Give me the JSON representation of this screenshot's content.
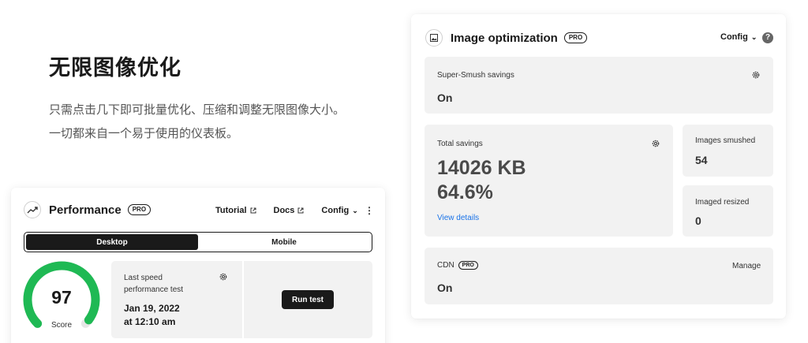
{
  "hero": {
    "title": "无限图像优化",
    "line1": "只需点击几下即可批量优化、压缩和调整无限图像大小。",
    "line2": "一切都来自一个易于使用的仪表板。"
  },
  "image_optimization": {
    "title": "Image optimization",
    "pro_badge": "PRO",
    "config_label": "Config",
    "help": "?",
    "super_smush": {
      "label": "Super-Smush savings",
      "value": "On"
    },
    "total_savings": {
      "label": "Total savings",
      "size": "14026 KB",
      "percent": "64.6%",
      "link": "View details"
    },
    "images_smushed": {
      "label": "Images smushed",
      "value": "54"
    },
    "images_resized": {
      "label": "Imaged resized",
      "value": "0"
    },
    "cdn": {
      "label": "CDN",
      "pro_badge": "PRO",
      "manage": "Manage",
      "value": "On"
    }
  },
  "performance": {
    "title": "Performance",
    "pro_badge": "PRO",
    "nav": {
      "tutorial": "Tutorial",
      "docs": "Docs",
      "config": "Config"
    },
    "tabs": {
      "desktop": "Desktop",
      "mobile": "Mobile"
    },
    "score": "97",
    "score_label": "Score",
    "score_fraction": 0.97,
    "last_test_label": "Last speed performance test",
    "date": "Jan 19, 2022",
    "time": "at 12:10 am",
    "run_button": "Run test"
  },
  "colors": {
    "score_green": "#1fb954",
    "gauge_track": "#e6e6e6",
    "link_blue": "#1a73e8",
    "dark": "#1a1a1a",
    "panel_bg": "#f2f2f2"
  },
  "icons": {
    "image": "image-icon",
    "trend": "trend-up-icon",
    "gear": "gear-icon",
    "external": "external-link-icon",
    "chevron": "chevron-down-icon",
    "help": "help-icon",
    "kebab": "kebab-menu-icon"
  }
}
